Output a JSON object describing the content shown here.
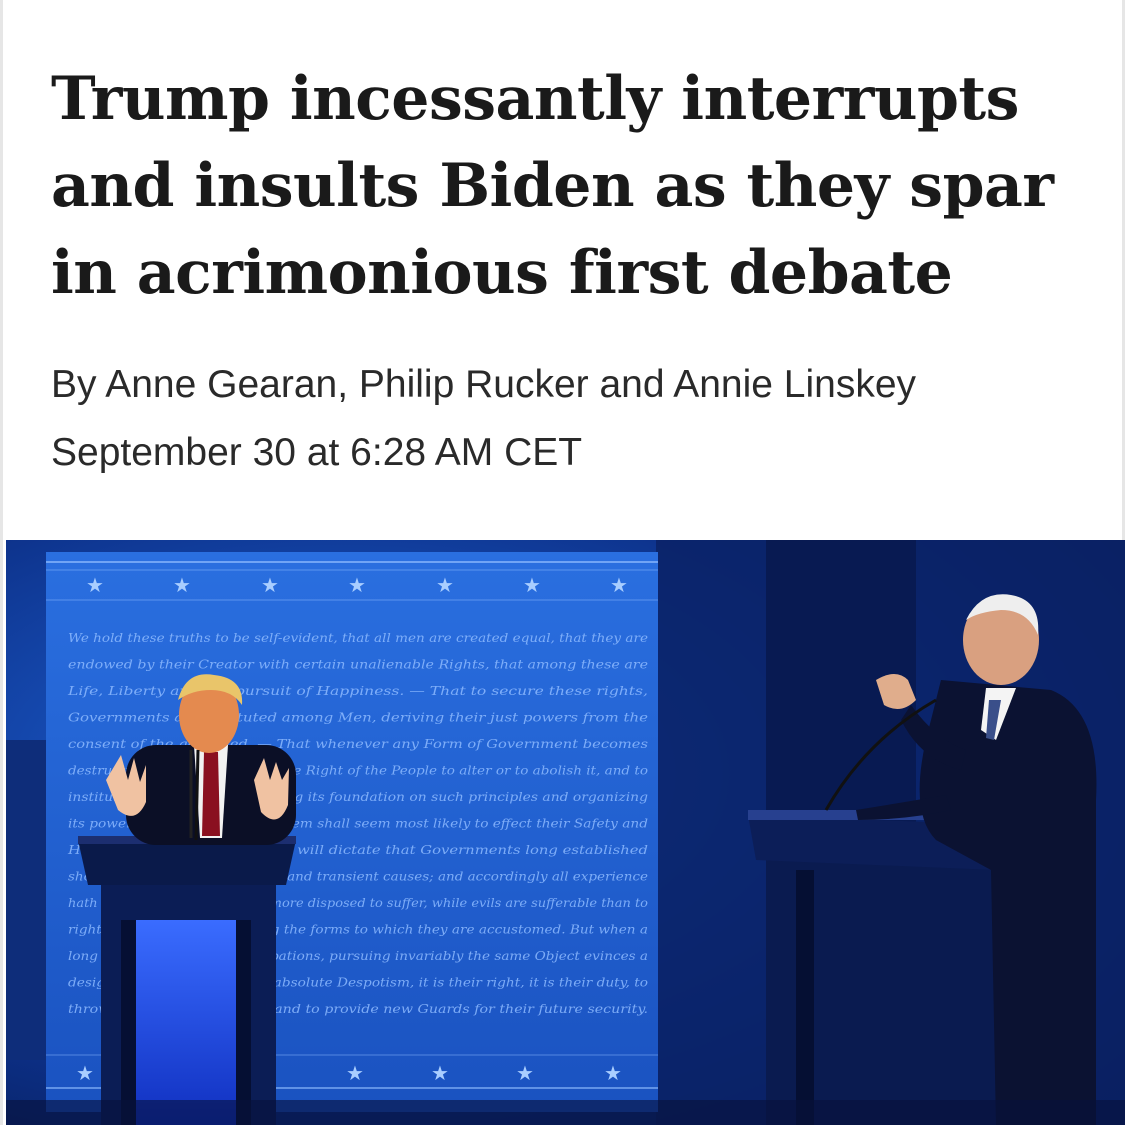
{
  "article": {
    "headline": "Trump incessantly interrupts and insults Biden as they spar in acrimonious first debate",
    "byline": "By Anne Gearan, Philip Rucker and Annie Linskey",
    "timestamp": "September 30 at 6:28 AM CET"
  },
  "photo": {
    "backdrop_text": [
      "We hold these truths to be self-evident, that all men are created equal, that they are",
      "endowed by their Creator with certain unalienable Rights, that among these are",
      "Life, Liberty and the pursuit of Happiness. — That to secure these rights,",
      "Governments are instituted among Men, deriving their just powers from the",
      "consent of the governed, — That whenever any Form of Government becomes",
      "destructive of these ends, it is the Right of the People to alter or to abolish it, and to",
      "institute new Government, laying its foundation on such principles and organizing",
      "its powers in such form, as to them shall seem most likely to effect their Safety and",
      "Happiness. Prudence, indeed, will dictate that Governments long established",
      "should not be changed for light and transient causes; and accordingly all experience",
      "hath shewn, that mankind are more disposed to suffer, while evils are sufferable than to",
      "right themselves by abolishing the forms to which they are accustomed. But when a",
      "long train of abuses and usurpations, pursuing invariably the same Object evinces a",
      "design to reduce them under absolute Despotism, it is their right, it is their duty, to",
      "throw off such Government, and to provide new Guards for their future security."
    ],
    "colors": {
      "backdrop": "#1f5fd0",
      "backdrop_text": "#7fb2ff",
      "stage": "#0a1f5c"
    }
  }
}
